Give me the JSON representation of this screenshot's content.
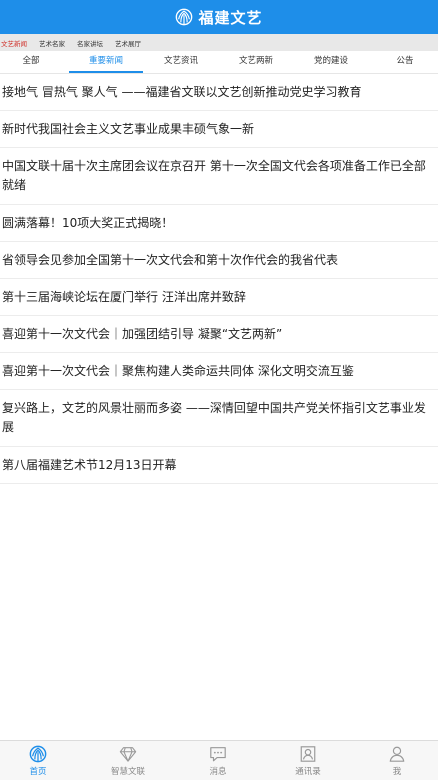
{
  "app": {
    "title": "福建文艺",
    "brand_color": "#1e8ee9",
    "logo_icon": "fujian-wenyi-logo-icon"
  },
  "subnav": {
    "items": [
      {
        "label": "文艺新闻",
        "active": true
      },
      {
        "label": "艺术名家",
        "active": false
      },
      {
        "label": "名家讲坛",
        "active": false
      },
      {
        "label": "艺术展厅",
        "active": false
      }
    ],
    "active_color": "#d0302a"
  },
  "tabs": [
    {
      "label": "全部",
      "active": false
    },
    {
      "label": "重要新闻",
      "active": true
    },
    {
      "label": "文艺资讯",
      "active": false
    },
    {
      "label": "文艺两新",
      "active": false
    },
    {
      "label": "党的建设",
      "active": false
    },
    {
      "label": "公告",
      "active": false
    }
  ],
  "news": [
    "接地气 冒热气 聚人气 ——福建省文联以文艺创新推动党史学习教育",
    "新时代我国社会主义文艺事业成果丰硕气象一新",
    "中国文联十届十次主席团会议在京召开 第十一次全国文代会各项准备工作已全部就绪",
    "圆满落幕！10项大奖正式揭晓！",
    "省领导会见参加全国第十一次文代会和第十次作代会的我省代表",
    "第十三届海峡论坛在厦门举行 汪洋出席并致辞",
    "喜迎第十一次文代会｜加强团结引导 凝聚“文艺两新”",
    "喜迎第十一次文代会｜聚焦构建人类命运共同体 深化文明交流互鉴",
    "复兴路上，文艺的风景壮丽而多姿 ——深情回望中国共产党关怀指引文艺事业发展",
    "第八届福建艺术节12月13日开幕"
  ],
  "bottom_nav": [
    {
      "label": "首页",
      "icon": "home-icon",
      "active": true
    },
    {
      "label": "智慧文联",
      "icon": "diamond-icon",
      "active": false
    },
    {
      "label": "消息",
      "icon": "message-icon",
      "active": false
    },
    {
      "label": "通讯录",
      "icon": "contacts-icon",
      "active": false
    },
    {
      "label": "我",
      "icon": "person-icon",
      "active": false
    }
  ]
}
